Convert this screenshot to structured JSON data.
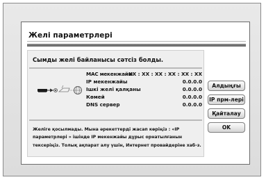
{
  "dialog": {
    "title": "Желі параметрлері",
    "status_message": "Сымды желі байланысы сәтсіз болды."
  },
  "network_info": [
    {
      "label": "MAC мекенжайы",
      "value": "XX : XX : XX : XX : XX : XX"
    },
    {
      "label": "IP мекенжайы",
      "value": "0.0.0.0"
    },
    {
      "label": "Ішкі желі қалқаны",
      "value": "0.0.0.0"
    },
    {
      "label": "Көмей",
      "value": "0.0.0.0"
    },
    {
      "label": "DNS сервер",
      "value": "0.0.0.0"
    }
  ],
  "help_text": "Желіге қосылмады. Мына әрекеттерді жасап көріңіз : «IP параметрлері » ішінде IP мекенжайы дұрыс орнатылғанын тексеріңіз. Толық ақпарат алу үшін, Интернет провайдеріне хаб-з.",
  "buttons": {
    "next": "Алдыңғы",
    "ip_settings": "IP прм-лері",
    "retry": "Қайталау",
    "ok": "OK"
  },
  "icons": {
    "player": "player-device-icon",
    "router": "router-icon",
    "internet": "globe-icon",
    "status": "connection-failed-icon"
  }
}
